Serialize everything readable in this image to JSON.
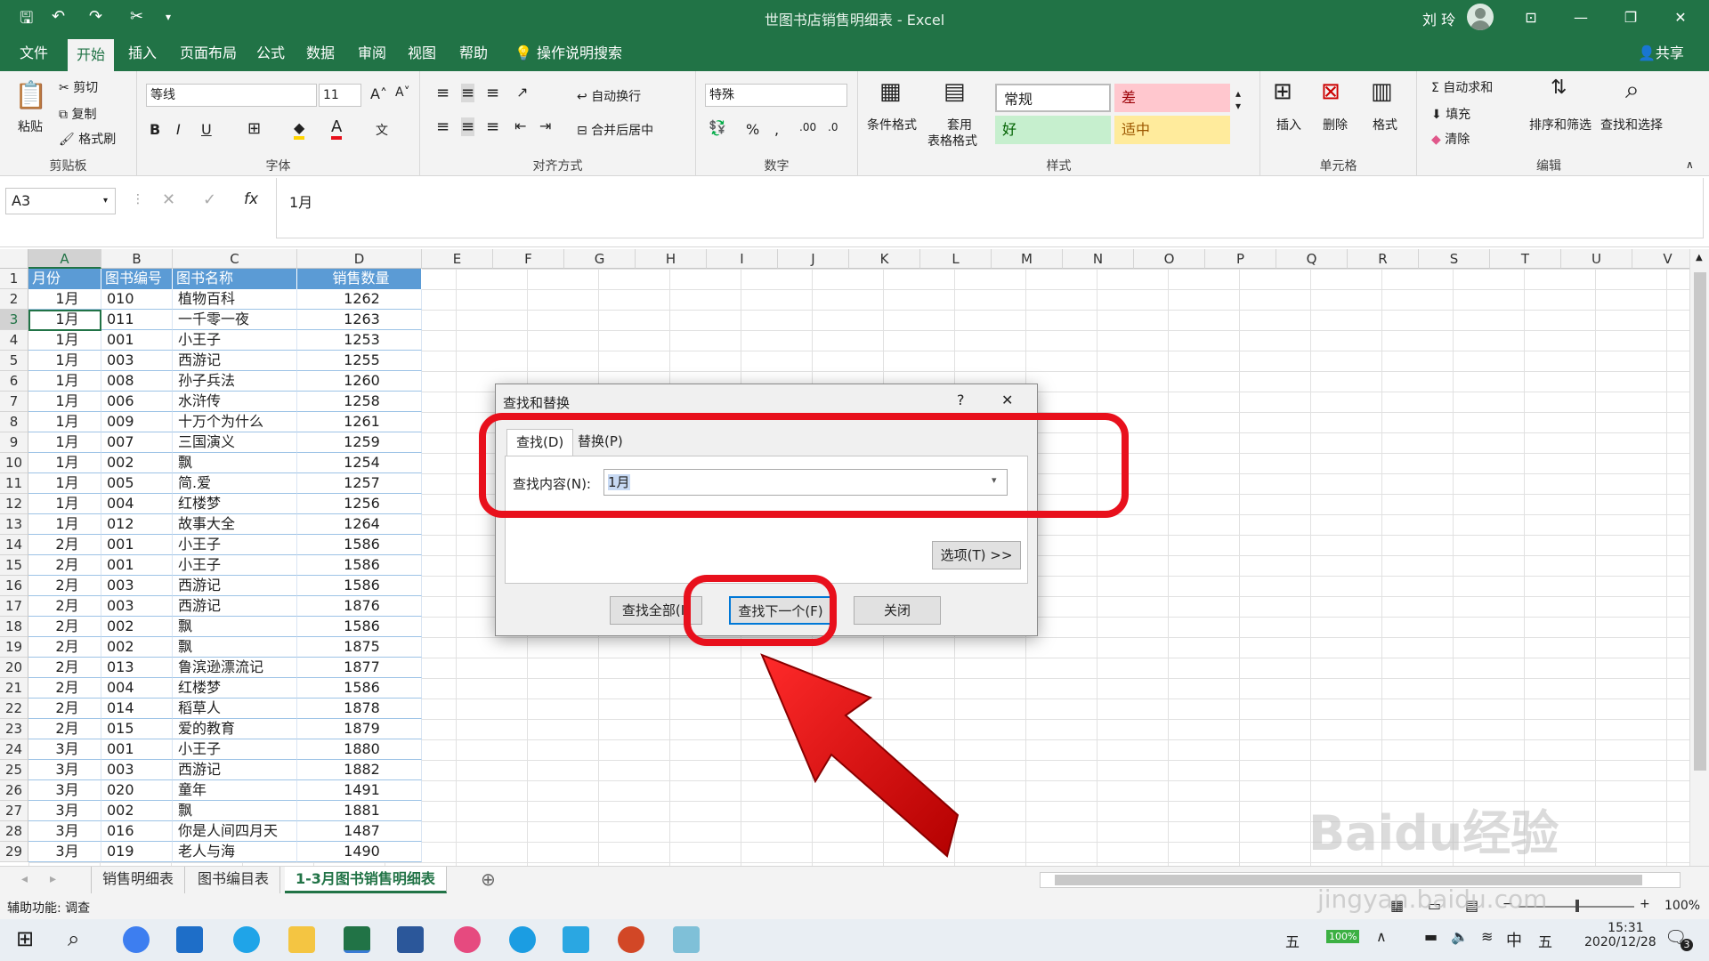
{
  "window": {
    "title": "世图书店销售明细表  -  Excel",
    "user": "刘 玲"
  },
  "menu": {
    "items": [
      "文件",
      "开始",
      "插入",
      "页面布局",
      "公式",
      "数据",
      "审阅",
      "视图",
      "帮助"
    ],
    "tell_me": "操作说明搜索",
    "share": "共享"
  },
  "ribbon": {
    "clipboard": {
      "paste": "粘贴",
      "cut": "剪切",
      "copy": "复制",
      "format_painter": "格式刷",
      "label": "剪贴板"
    },
    "font": {
      "name": "等线",
      "size": "11",
      "label": "字体"
    },
    "alignment": {
      "wrap": "自动换行",
      "merge": "合并后居中",
      "label": "对齐方式"
    },
    "number": {
      "format": "特殊",
      "label": "数字"
    },
    "styles": {
      "conditional": "条件格式",
      "table_format_1": "套用",
      "table_format_2": "表格格式",
      "normal": "常规",
      "bad": "差",
      "good": "好",
      "neutral": "适中",
      "label": "样式"
    },
    "cells": {
      "insert": "插入",
      "delete": "删除",
      "format": "格式",
      "label": "单元格"
    },
    "editing": {
      "autosum": "自动求和",
      "fill": "填充",
      "clear": "清除",
      "sort": "排序和筛选",
      "find": "查找和选择",
      "label": "编辑"
    }
  },
  "formula_bar": {
    "name_box": "A3",
    "content": "1月",
    "fx": "fx"
  },
  "columns": [
    "A",
    "B",
    "C",
    "D",
    "E",
    "F",
    "G",
    "H",
    "I",
    "J",
    "K",
    "L",
    "M",
    "N",
    "O",
    "P",
    "Q",
    "R",
    "S",
    "T",
    "U",
    "V"
  ],
  "header_row": [
    "月份",
    "图书编号",
    "图书名称",
    "销售数量"
  ],
  "rows": [
    [
      "1月",
      "010",
      "植物百科",
      "1262"
    ],
    [
      "1月",
      "011",
      "一千零一夜",
      "1263"
    ],
    [
      "1月",
      "001",
      "小王子",
      "1253"
    ],
    [
      "1月",
      "003",
      "西游记",
      "1255"
    ],
    [
      "1月",
      "008",
      "孙子兵法",
      "1260"
    ],
    [
      "1月",
      "006",
      "水浒传",
      "1258"
    ],
    [
      "1月",
      "009",
      "十万个为什么",
      "1261"
    ],
    [
      "1月",
      "007",
      "三国演义",
      "1259"
    ],
    [
      "1月",
      "002",
      "飘",
      "1254"
    ],
    [
      "1月",
      "005",
      "简.爱",
      "1257"
    ],
    [
      "1月",
      "004",
      "红楼梦",
      "1256"
    ],
    [
      "1月",
      "012",
      "故事大全",
      "1264"
    ],
    [
      "2月",
      "001",
      "小王子",
      "1586"
    ],
    [
      "2月",
      "001",
      "小王子",
      "1586"
    ],
    [
      "2月",
      "003",
      "西游记",
      "1586"
    ],
    [
      "2月",
      "003",
      "西游记",
      "1876"
    ],
    [
      "2月",
      "002",
      "飘",
      "1586"
    ],
    [
      "2月",
      "002",
      "飘",
      "1875"
    ],
    [
      "2月",
      "013",
      "鲁滨逊漂流记",
      "1877"
    ],
    [
      "2月",
      "004",
      "红楼梦",
      "1586"
    ],
    [
      "2月",
      "014",
      "稻草人",
      "1878"
    ],
    [
      "2月",
      "015",
      "爱的教育",
      "1879"
    ],
    [
      "3月",
      "001",
      "小王子",
      "1880"
    ],
    [
      "3月",
      "003",
      "西游记",
      "1882"
    ],
    [
      "3月",
      "020",
      "童年",
      "1491"
    ],
    [
      "3月",
      "002",
      "飘",
      "1881"
    ],
    [
      "3月",
      "016",
      "你是人间四月天",
      "1487"
    ],
    [
      "3月",
      "019",
      "老人与海",
      "1490"
    ]
  ],
  "sheet_tabs": [
    "销售明细表",
    "图书编目表",
    "1-3月图书销售明细表"
  ],
  "status": {
    "accessibility": "辅助功能: 调查",
    "zoom": "100%"
  },
  "dialog": {
    "title": "查找和替换",
    "help": "?",
    "close": "✕",
    "tab_find": "查找(D)",
    "tab_replace": "替换(P)",
    "find_label": "查找内容(N):",
    "find_value": "1月",
    "options": "选项(T) >>",
    "find_all": "查找全部(I)",
    "find_next": "查找下一个(F)",
    "close_btn": "关闭"
  },
  "taskbar": {
    "ime": "五",
    "battery": "100%",
    "lang": "中",
    "ime2": "五",
    "time": "15:31",
    "date": "2020/12/28",
    "notifications": "3"
  },
  "watermark": {
    "brand": "Baidu经验",
    "url": "jingyan.baidu.com"
  },
  "colors": {
    "excel_green": "#217346",
    "header_fill": "#5b9bd5",
    "annotation_red": "#e8101c"
  }
}
